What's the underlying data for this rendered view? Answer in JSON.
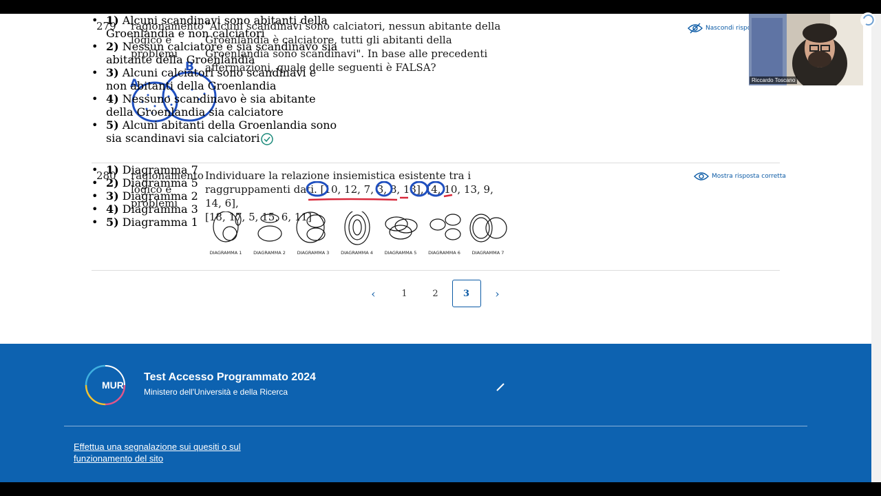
{
  "question_279": {
    "number": "279",
    "category": "ragionamento logico e problemi",
    "text": "\"Alcuni scandinavi sono calciatori, nessun abitante della Groenlandia è calciatore, tutti gli abitanti della Groenlandia sono scandinavi\". In base alle precedenti affermazioni, quale delle seguenti è FALSA?",
    "reveal_label": "Nascondi risposta",
    "sketch_label_a": "A",
    "sketch_label_b": "B",
    "answers": [
      {
        "n": "1)",
        "text": "Alcuni scandinavi sono abitanti della Groenlandia e non calciatori"
      },
      {
        "n": "2)",
        "text": "Nessun calciatore è sia scandinavo sia abitante della Groenlandia"
      },
      {
        "n": "3)",
        "text": "Alcuni calciatori sono scandinavi e non abitanti della Groenlandia"
      },
      {
        "n": "4)",
        "text": "Nessuno scandinavo è sia abitante della Groenlandia sia calciatore"
      },
      {
        "n": "5)",
        "text": "Alcuni abitanti della Groenlandia sono sia scandinavi sia calciatori"
      }
    ]
  },
  "question_280": {
    "number": "280",
    "category": "ragionamento logico e problemi",
    "text_line1": "Individuare la relazione insiemistica esistente tra i",
    "text_line2": "raggruppamenti dati. [10, 12, 7, 3, 8, 13], [4, 10, 13, 9, 14, 6],",
    "text_line3": "[18, 17, 5, 15, 6, 11]",
    "reveal_label": "Mostra risposta corretta",
    "diagrams": [
      "DIAGRAMMA 1",
      "DIAGRAMMA 2",
      "DIAGRAMMA 3",
      "DIAGRAMMA 4",
      "DIAGRAMMA 5",
      "DIAGRAMMA 6",
      "DIAGRAMMA 7"
    ],
    "answers": [
      {
        "n": "1)",
        "text": "Diagramma 7"
      },
      {
        "n": "2)",
        "text": "Diagramma 5"
      },
      {
        "n": "3)",
        "text": "Diagramma 2"
      },
      {
        "n": "4)",
        "text": "Diagramma 3"
      },
      {
        "n": "5)",
        "text": "Diagramma 1"
      }
    ]
  },
  "pagination": {
    "prev": "‹",
    "pages": [
      "1",
      "2",
      "3"
    ],
    "current": "3",
    "next": "›"
  },
  "footer": {
    "logo_text": "MUR",
    "title": "Test Accesso Programmato 2024",
    "subtitle": "Ministero dell'Università e della Ricerca",
    "report_link": "Effettua una segnalazione sui quesiti o sul funzionamento del sito"
  },
  "webcam": {
    "name": "Riccardo Toscano"
  },
  "colors": {
    "brand_blue": "#0d62b0",
    "link_blue": "#0b5aa5",
    "annotation_blue": "#1f4fbf",
    "annotation_red": "#d8283a",
    "check_teal": "#1a8a7a"
  }
}
